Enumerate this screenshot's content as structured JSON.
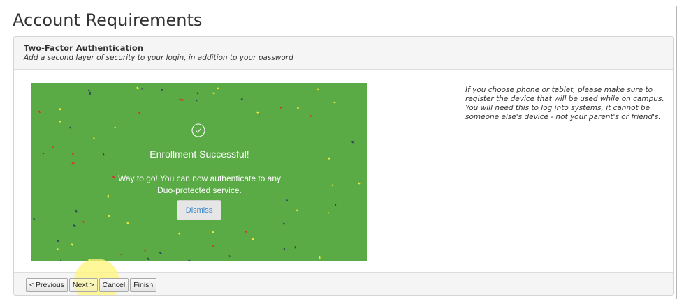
{
  "page": {
    "title": "Account Requirements"
  },
  "panel": {
    "title": "Two-Factor Authentication",
    "subtitle": "Add a second layer of security to your login, in addition to your password"
  },
  "duo": {
    "background_color": "#5aaa45",
    "check_icon": "check-circle-icon",
    "title": "Enrollment Successful!",
    "message": "Way to go! You can now authenticate to any Duo-protected service.",
    "dismiss_label": "Dismiss"
  },
  "side_note": {
    "text": "If you choose phone or tablet, please make sure to register the device that will be used while on campus. You will need this to log into systems, it cannot be someone else's device - not your parent's or friend's."
  },
  "footer": {
    "previous_label": "< Previous",
    "next_label": "Next >",
    "cancel_label": "Cancel",
    "finish_label": "Finish"
  }
}
